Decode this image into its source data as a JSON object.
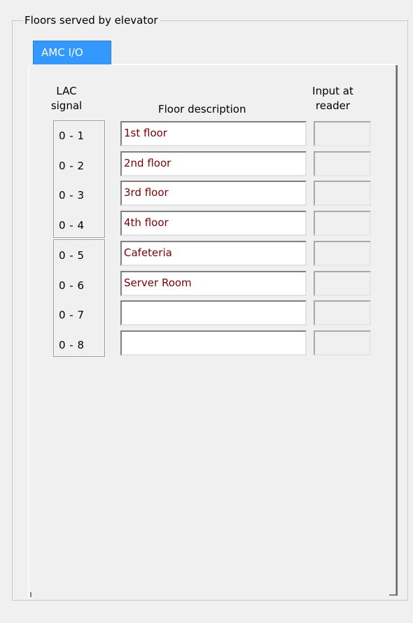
{
  "group": {
    "title": "Floors served by elevator"
  },
  "tabs": [
    {
      "label": "AMC I/O",
      "selected": true
    }
  ],
  "headers": {
    "lac_line1": "LAC",
    "lac_line2": "signal",
    "floor_description": "Floor description",
    "input_line1": "Input at",
    "input_line2": "reader"
  },
  "rows": [
    {
      "signal": "0 - 1",
      "description": "1st floor",
      "reader": ""
    },
    {
      "signal": "0 - 2",
      "description": "2nd floor",
      "reader": ""
    },
    {
      "signal": "0 - 3",
      "description": "3rd floor",
      "reader": ""
    },
    {
      "signal": "0 - 4",
      "description": "4th floor",
      "reader": ""
    },
    {
      "signal": "0 - 5",
      "description": "Cafeteria",
      "reader": ""
    },
    {
      "signal": "0 - 6",
      "description": "Server Room",
      "reader": ""
    },
    {
      "signal": "0 - 7",
      "description": "",
      "reader": ""
    },
    {
      "signal": "0 - 8",
      "description": "",
      "reader": ""
    }
  ],
  "colors": {
    "tab_selected": "#3399ff",
    "description_text": "#800000",
    "window_background": "#f0f0f0"
  }
}
